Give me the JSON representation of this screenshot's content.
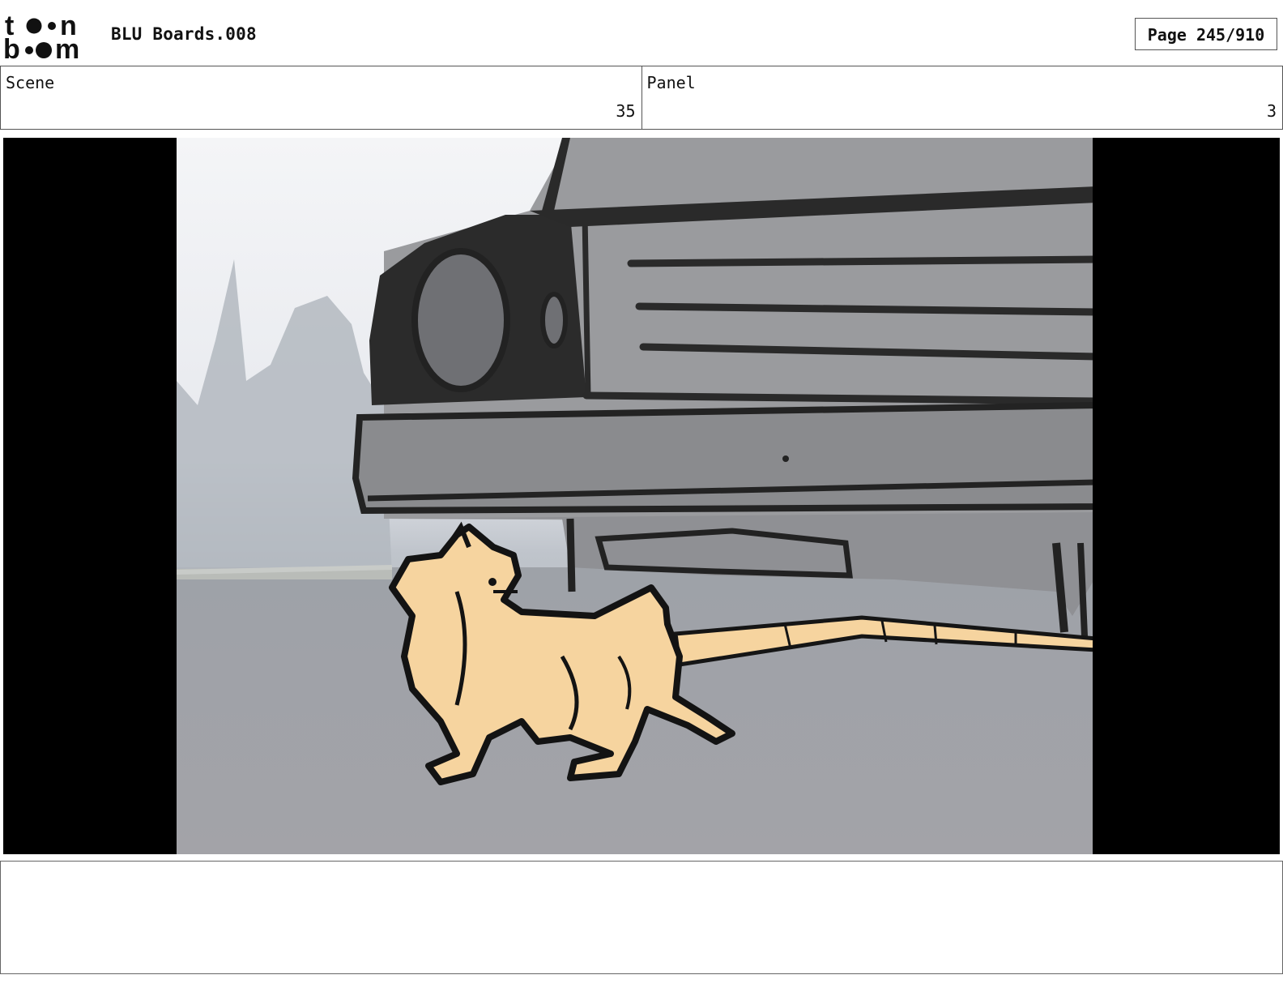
{
  "header": {
    "logo_text": "toon boom",
    "project_title": "BLU Boards.008",
    "page_label": "Page 245/910"
  },
  "info": {
    "scene_label": "Scene",
    "scene_value": "35",
    "panel_label": "Panel",
    "panel_value": "3"
  },
  "notes": {
    "text": ""
  }
}
